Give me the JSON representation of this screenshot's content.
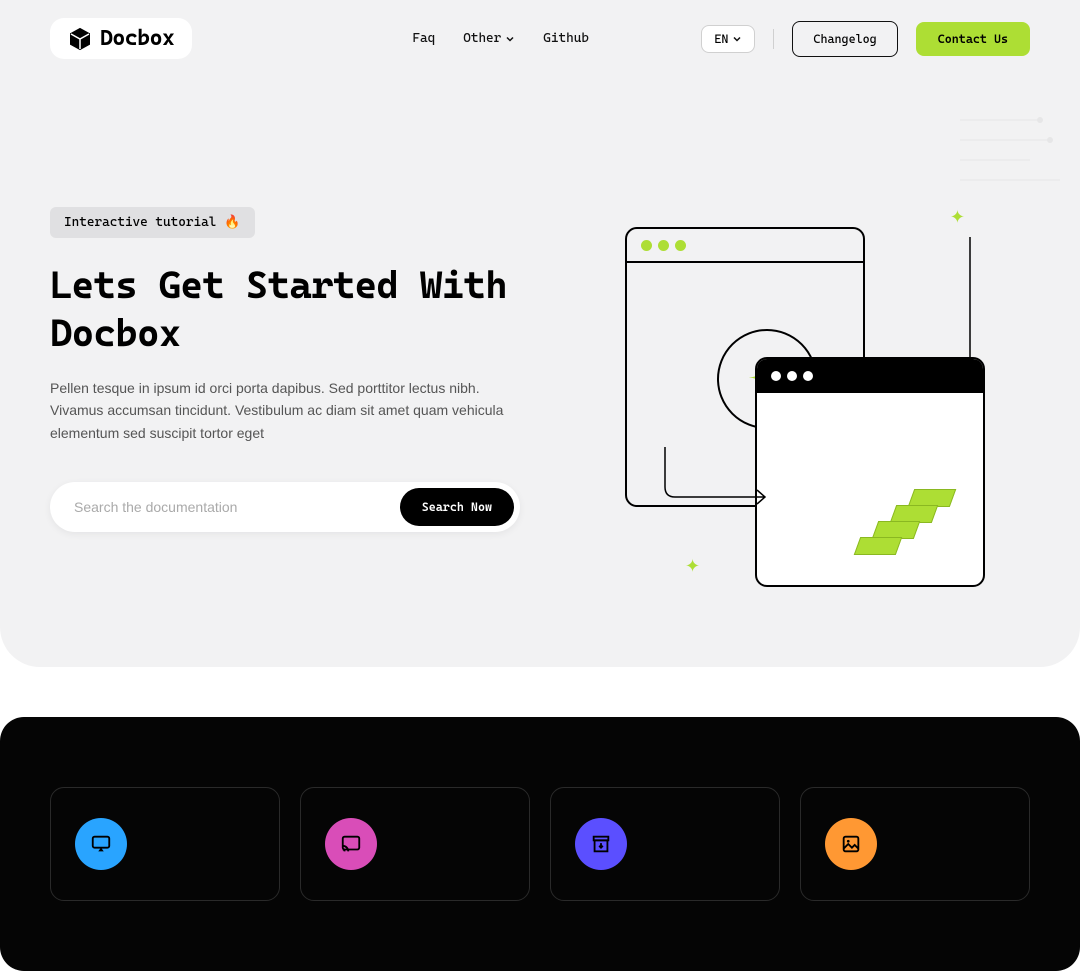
{
  "header": {
    "logo_text": "Docbox",
    "nav": {
      "faq": "Faq",
      "other": "Other",
      "github": "Github"
    },
    "lang": "EN",
    "changelog": "Changelog",
    "contact": "Contact Us"
  },
  "hero": {
    "badge": "Interactive tutorial",
    "badge_emoji": "🔥",
    "title": "Lets Get Started With Docbox",
    "description": "Pellen tesque in ipsum id orci porta dapibus. Sed porttitor lectus nibh. Vivamus accumsan tincidunt. Vestibulum ac diam sit amet quam vehicula elementum sed suscipit tortor eget",
    "search_placeholder": "Search the documentation",
    "search_button": "Search Now"
  },
  "colors": {
    "accent": "#adde34",
    "dark": "#050505"
  }
}
